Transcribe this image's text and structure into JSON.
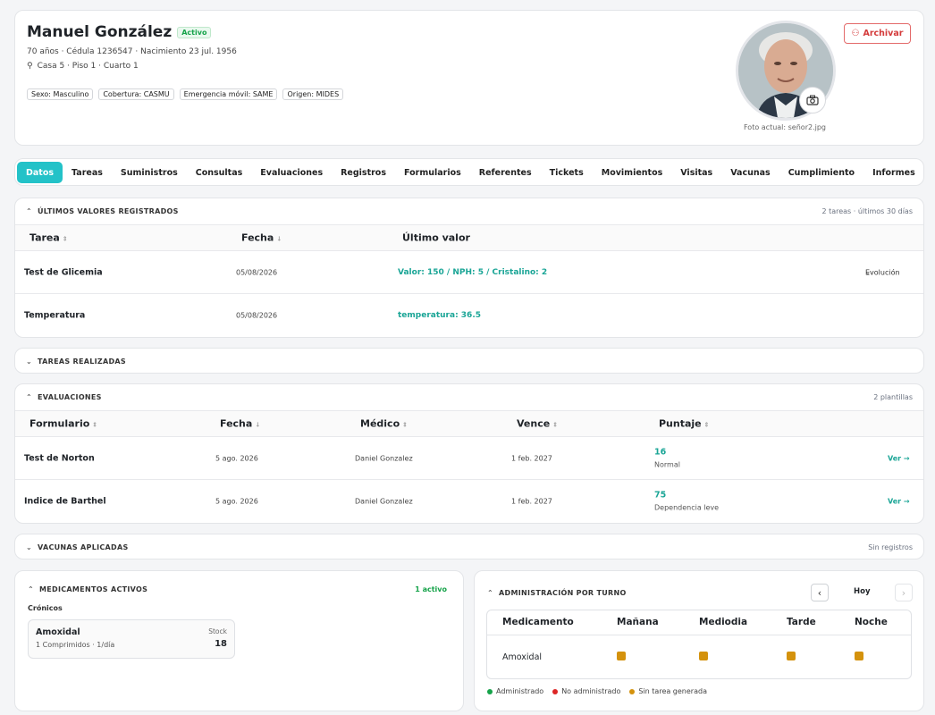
{
  "profile": {
    "name": "Manuel González",
    "status": "Activo",
    "details": "70 años · Cédula 1236547 · Nacimiento 23 jul. 1956",
    "location": "Casa 5 · Piso 1 · Cuarto 1",
    "tags": [
      "Sexo: Masculino",
      "Cobertura: CASMU",
      "Emergencia móvil: SAME",
      "Origen: MIDES"
    ],
    "archive_label": "Archivar",
    "photo_caption": "Foto actual: señor2.jpg"
  },
  "tabs": [
    "Datos",
    "Tareas",
    "Suministros",
    "Consultas",
    "Evaluaciones",
    "Registros",
    "Formularios",
    "Referentes",
    "Tickets",
    "Movimientos",
    "Visitas",
    "Vacunas",
    "Cumplimiento",
    "Informes"
  ],
  "ultimos": {
    "title": "ÚLTIMOS VALORES REGISTRADOS",
    "summary": "2 tareas · últimos 30 días",
    "headers": [
      "Tarea",
      "Fecha",
      "Último valor"
    ],
    "rows": [
      {
        "tarea": "Test de Glicemia",
        "fecha": "05/08/2026",
        "valor": "Valor: 150 / NPH: 5 / Cristalino: 2",
        "action": "Evolución"
      },
      {
        "tarea": "Temperatura",
        "fecha": "05/08/2026",
        "valor": "temperatura: 36.5",
        "action": ""
      }
    ]
  },
  "tareas_realizadas": {
    "title": "TAREAS REALIZADAS"
  },
  "evaluaciones": {
    "title": "EVALUACIONES",
    "summary": "2 plantillas",
    "headers": [
      "Formulario",
      "Fecha",
      "Médico",
      "Vence",
      "Puntaje"
    ],
    "rows": [
      {
        "formulario": "Test de Norton",
        "fecha": "5 ago. 2026",
        "medico": "Daniel Gonzalez",
        "vence": "1 feb. 2027",
        "puntaje": "16",
        "nivel": "Normal",
        "action": "Ver →"
      },
      {
        "formulario": "Indice de Barthel",
        "fecha": "5 ago. 2026",
        "medico": "Daniel Gonzalez",
        "vence": "1 feb. 2027",
        "puntaje": "75",
        "nivel": "Dependencia leve",
        "action": "Ver →"
      }
    ]
  },
  "vacunas": {
    "title": "VACUNAS APLICADAS",
    "summary": "Sin registros"
  },
  "medicamentos": {
    "title": "MEDICAMENTOS ACTIVOS",
    "count": "1 activo",
    "group": "Crónicos",
    "item": {
      "name": "Amoxidal",
      "dose": "1 Comprimidos · 1/día",
      "stock_label": "Stock",
      "stock": "18"
    }
  },
  "administracion": {
    "title": "ADMINISTRACIÓN POR TURNO",
    "day": "Hoy",
    "headers": [
      "Medicamento",
      "Mañana",
      "Mediodia",
      "Tarde",
      "Noche"
    ],
    "row": {
      "medicamento": "Amoxidal"
    },
    "legend": [
      "Administrado",
      "No administrado",
      "Sin tarea generada"
    ],
    "colors": {
      "administrado": "#16a34a",
      "no_administrado": "#dc2626",
      "sin_tarea": "#d4920d"
    }
  }
}
